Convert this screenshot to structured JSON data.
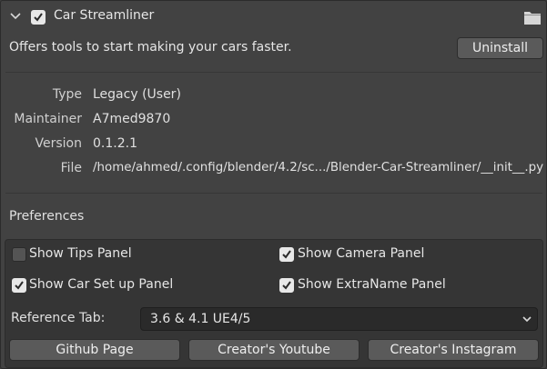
{
  "addon": {
    "name": "Car Streamliner",
    "enabled": true,
    "description": "Offers tools to start making your cars faster.",
    "uninstall_label": "Uninstall"
  },
  "info": [
    {
      "label": "Type",
      "value": "Legacy (User)"
    },
    {
      "label": "Maintainer",
      "value": "A7med9870"
    },
    {
      "label": "Version",
      "value": "0.1.2.1"
    },
    {
      "label": "File",
      "value": "/home/ahmed/.config/blender/4.2/sc.../Blender-Car-Streamliner/__init__.py"
    }
  ],
  "preferences": {
    "title": "Preferences",
    "options": [
      {
        "label": "Show Tips Panel",
        "checked": false
      },
      {
        "label": "Show Camera Panel",
        "checked": true
      },
      {
        "label": "Show Car Set up Panel",
        "checked": true
      },
      {
        "label": "Show ExtraName Panel",
        "checked": true
      }
    ],
    "reference_tab_label": "Reference Tab:",
    "reference_tab_value": "3.6 & 4.1 UE4/5",
    "buttons": [
      "Github Page",
      "Creator's Youtube",
      "Creator's Instagram"
    ]
  },
  "icons": {
    "expand": "chevron-down-icon",
    "folder": "folder-icon",
    "check": "checkmark-icon"
  }
}
